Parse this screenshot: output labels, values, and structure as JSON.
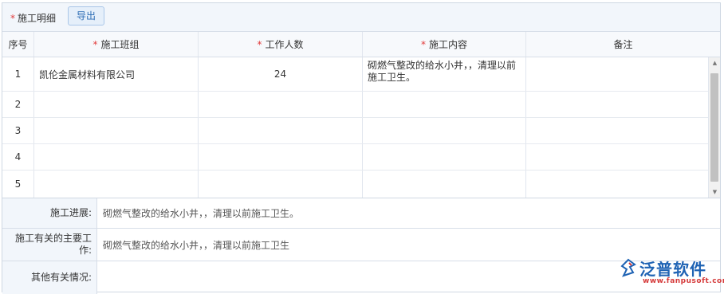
{
  "toolbar": {
    "required_mark": "*",
    "title": "施工明细",
    "export_label": "导出"
  },
  "table": {
    "columns": [
      {
        "label": "序号",
        "required": false
      },
      {
        "label": "施工班组",
        "required": true
      },
      {
        "label": "工作人数",
        "required": true
      },
      {
        "label": "施工内容",
        "required": true
      },
      {
        "label": "备注",
        "required": false
      }
    ],
    "rows": [
      {
        "index": "1",
        "team": "凯伦金属材料有限公司",
        "workers": "24",
        "content": "砌燃气整改的给水小井，，清理以前施工卫生。",
        "note": ""
      },
      {
        "index": "2",
        "team": "",
        "workers": "",
        "content": "",
        "note": ""
      },
      {
        "index": "3",
        "team": "",
        "workers": "",
        "content": "",
        "note": ""
      },
      {
        "index": "4",
        "team": "",
        "workers": "",
        "content": "",
        "note": ""
      },
      {
        "index": "5",
        "team": "",
        "workers": "",
        "content": "",
        "note": ""
      }
    ]
  },
  "form": {
    "progress_label": "施工进展:",
    "progress_value": "砌燃气整改的给水小井，，清理以前施工卫生。",
    "main_work_label": "施工有关的主要工作:",
    "main_work_value": "砌燃气整改的给水小井，，清理以前施工卫生",
    "other_label": "其他有关情况:",
    "other_value": ""
  },
  "watermark": {
    "name": "泛普软件",
    "url": "www.fanpusoft.com"
  },
  "icons": {
    "scroll_up": "triangle-up-icon",
    "scroll_down": "triangle-down-icon",
    "logo": "fanpu-logo-icon"
  },
  "colors": {
    "required": "#e23b3b",
    "accent": "#2d6db5",
    "header_bg": "#f2f6fb",
    "watermark_blue": "#1f63b4",
    "watermark_red": "#d53a3a"
  }
}
